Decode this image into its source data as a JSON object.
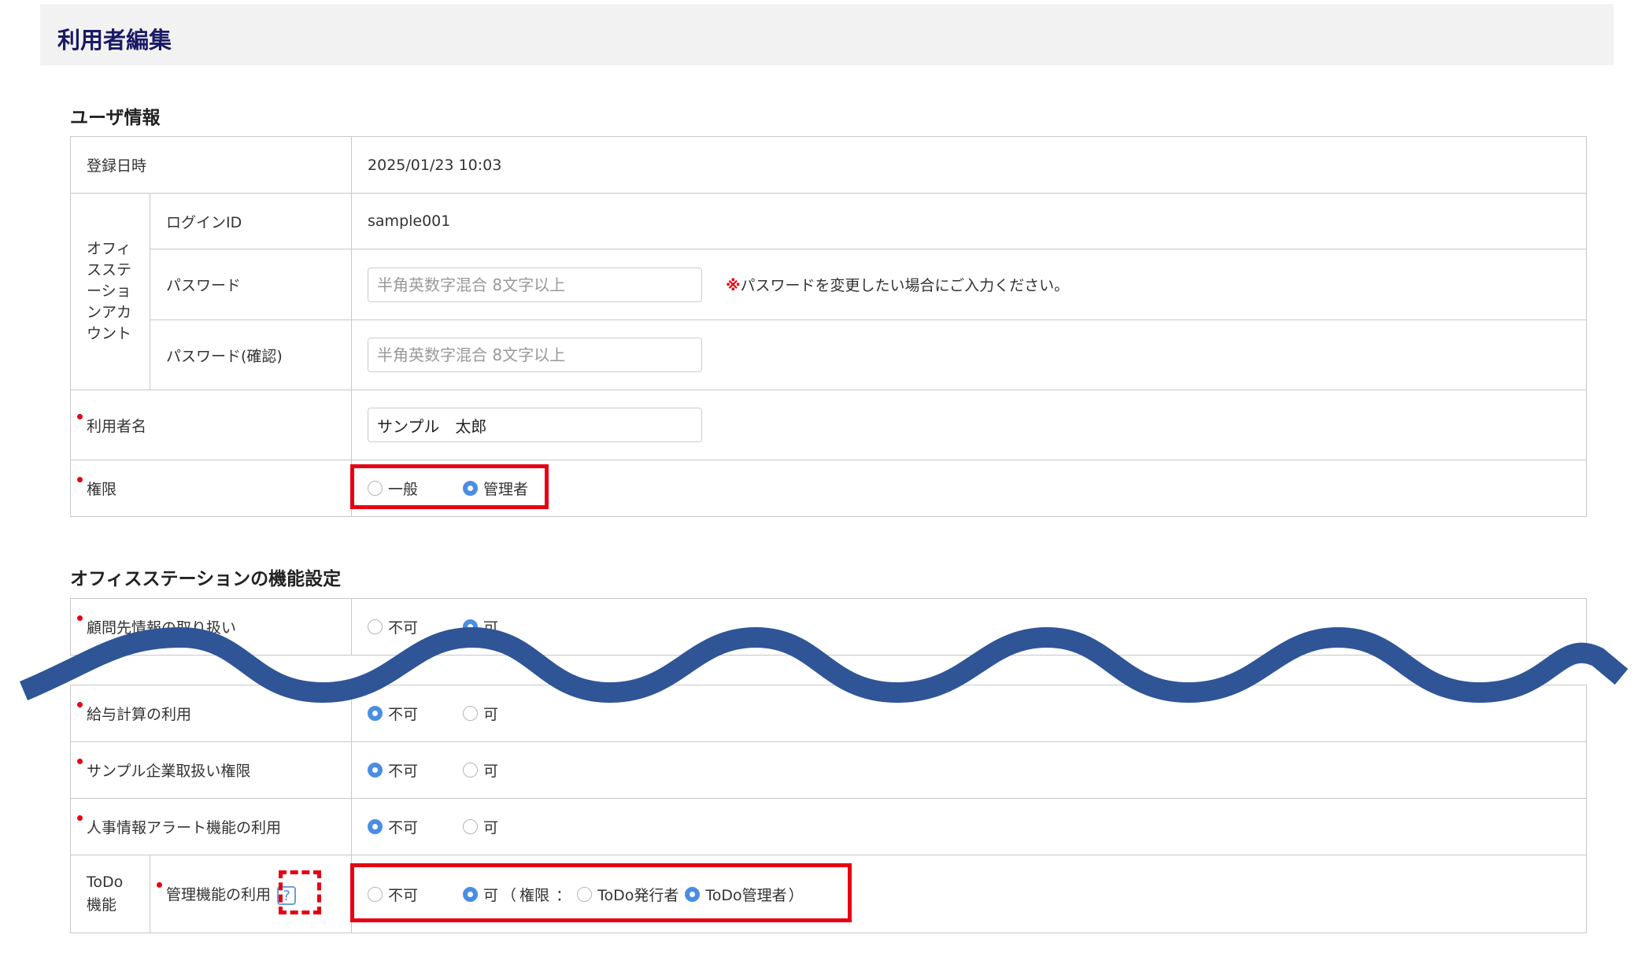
{
  "page": {
    "title": "利用者編集"
  },
  "user_section": {
    "title": "ユーザ情報",
    "registered_label": "登録日時",
    "registered_value": "2025/01/23 10:03",
    "account_group_label": "オフィ\nスステ\nーショ\nンアカ\nウント",
    "login_id_label": "ログインID",
    "login_id_value": "sample001",
    "password_label": "パスワード",
    "password_placeholder": "半角英数字混合 8文字以上",
    "password_note_mark": "※",
    "password_note": "パスワードを変更したい場合にご入力ください。",
    "password_confirm_label": "パスワード(確認)",
    "password_confirm_placeholder": "半角英数字混合 8文字以上",
    "user_name_label": "利用者名",
    "user_name_value": "サンプル　太郎",
    "role_label": "権限",
    "role_options": [
      "一般",
      "管理者"
    ],
    "role_selected": "管理者"
  },
  "features_section": {
    "title": "オフィスステーションの機能設定",
    "rows": [
      {
        "label": "顧問先情報の取り扱い",
        "options": [
          "不可",
          "可"
        ],
        "selected": "可"
      },
      {
        "label": "給与計算の利用",
        "options": [
          "不可",
          "可"
        ],
        "selected": "不可"
      },
      {
        "label": "サンプル企業取扱い権限",
        "options": [
          "不可",
          "可"
        ],
        "selected": "不可"
      },
      {
        "label": "人事情報アラート機能の利用",
        "options": [
          "不可",
          "可"
        ],
        "selected": "不可"
      }
    ],
    "todo": {
      "group_label": "ToDo\n機能",
      "label": "管理機能の利用",
      "help_icon": "?",
      "option_ng": "不可",
      "option_ok": "可",
      "paren_open": "（",
      "authority_label": "権限",
      "colon": "：",
      "sub_options": [
        "ToDo発行者",
        "ToDo管理者"
      ],
      "paren_close": "）",
      "selected": "可",
      "sub_selected": "ToDo管理者"
    }
  },
  "colors": {
    "required_dot": "#e60012",
    "radio_selected": "#4a8ee4",
    "highlight_box": "#e60012",
    "wave": "#2f5597",
    "title": "#1a1a66"
  }
}
